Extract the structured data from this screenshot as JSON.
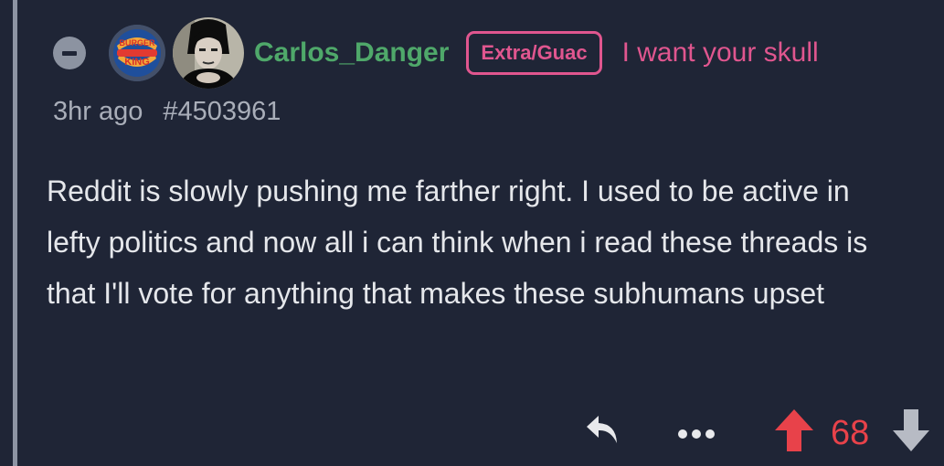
{
  "comment": {
    "username": "Carlos_Danger",
    "flair": "Extra/Guac",
    "user_text": "I want your skull",
    "time_ago": "3hr ago",
    "comment_id": "#4503961",
    "body": "Reddit is slowly pushing me farther right. I used to be active in lefty politics and now all i can think when i read these threads is that I'll vote for anything that makes these subhumans upset",
    "community_icon": {
      "name": "burger-king-logo",
      "text_top": "BURGER",
      "text_bottom": "KING"
    },
    "avatar_icon": "user-avatar-photo"
  },
  "actions": {
    "score": "68",
    "reply_icon": "reply-arrow-icon",
    "more_icon": "ellipsis-icon",
    "upvote_icon": "arrow-up-icon",
    "downvote_icon": "arrow-down-icon"
  },
  "colors": {
    "background": "#1f2536",
    "username": "#4fa86a",
    "flair": "#e0568f",
    "upvoted": "#e8424a",
    "muted": "#a9aeb9",
    "body_text": "#e5e7eb"
  }
}
